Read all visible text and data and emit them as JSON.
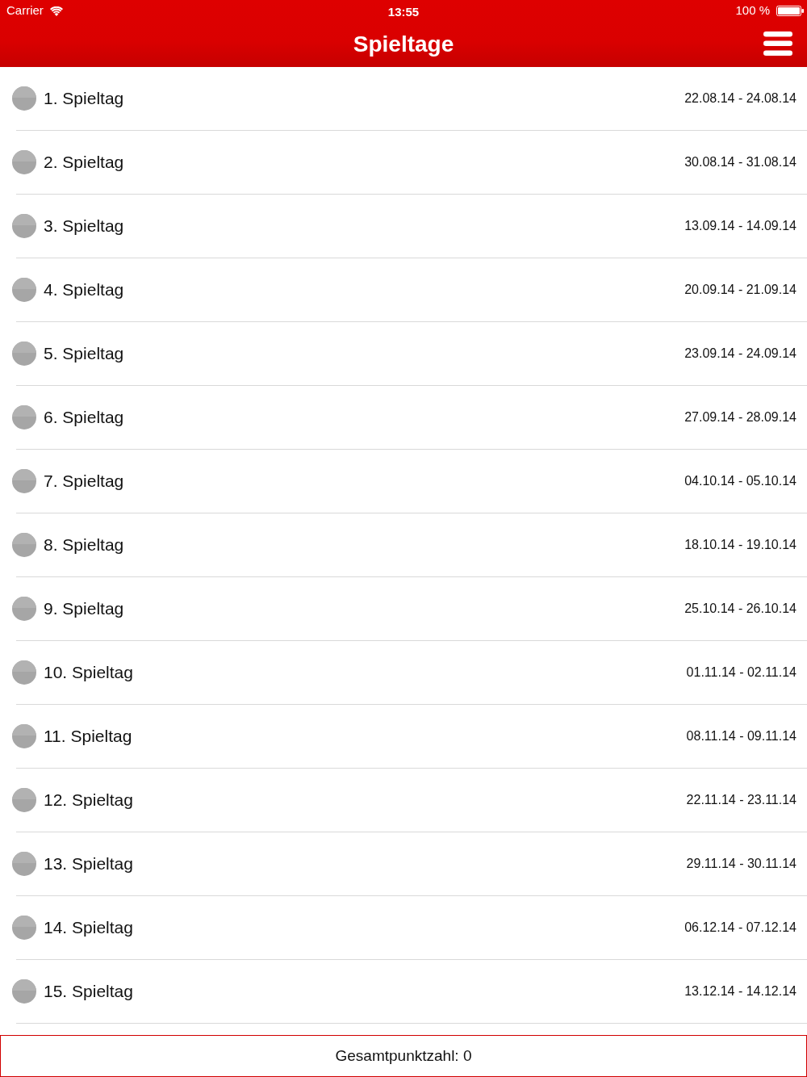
{
  "status_bar": {
    "carrier": "Carrier",
    "time": "13:55",
    "battery": "100 %"
  },
  "nav_bar": {
    "title": "Spieltage"
  },
  "matchdays": [
    {
      "name": "1. Spieltag",
      "dates": "22.08.14 - 24.08.14"
    },
    {
      "name": "2. Spieltag",
      "dates": "30.08.14 - 31.08.14"
    },
    {
      "name": "3. Spieltag",
      "dates": "13.09.14 - 14.09.14"
    },
    {
      "name": "4. Spieltag",
      "dates": "20.09.14 - 21.09.14"
    },
    {
      "name": "5. Spieltag",
      "dates": "23.09.14 - 24.09.14"
    },
    {
      "name": "6. Spieltag",
      "dates": "27.09.14 - 28.09.14"
    },
    {
      "name": "7. Spieltag",
      "dates": "04.10.14 - 05.10.14"
    },
    {
      "name": "8. Spieltag",
      "dates": "18.10.14 - 19.10.14"
    },
    {
      "name": "9. Spieltag",
      "dates": "25.10.14 - 26.10.14"
    },
    {
      "name": "10. Spieltag",
      "dates": "01.11.14 - 02.11.14"
    },
    {
      "name": "11. Spieltag",
      "dates": "08.11.14 - 09.11.14"
    },
    {
      "name": "12. Spieltag",
      "dates": "22.11.14 - 23.11.14"
    },
    {
      "name": "13. Spieltag",
      "dates": "29.11.14 - 30.11.14"
    },
    {
      "name": "14. Spieltag",
      "dates": "06.12.14 - 07.12.14"
    },
    {
      "name": "15. Spieltag",
      "dates": "13.12.14 - 14.12.14"
    }
  ],
  "footer": {
    "text": "Gesamtpunktzahl: 0"
  }
}
